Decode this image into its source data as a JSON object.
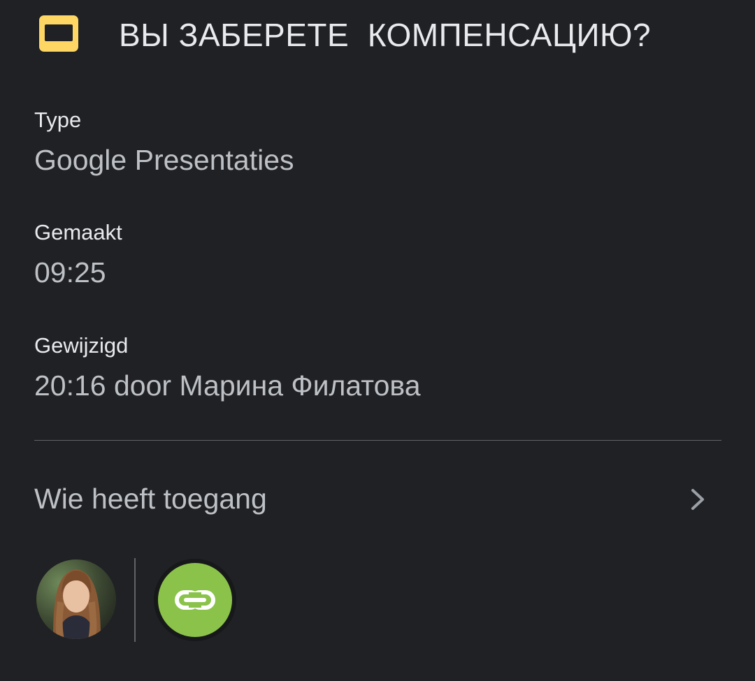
{
  "header": {
    "icon": "slides-icon",
    "icon_color": "#fdd663",
    "title": "ВЫ ЗАБЕРЕТЕ  КОМПЕНСАЦИЮ?"
  },
  "details": {
    "type_label": "Type",
    "type_value": "Google Presentaties",
    "created_label": "Gemaakt",
    "created_value": "09:25",
    "modified_label": "Gewijzigd",
    "modified_value": "20:16 door Марина Филатова"
  },
  "access": {
    "label": "Wie heeft toegang",
    "chevron_icon": "chevron-right-icon",
    "link_icon": "link-icon",
    "link_color": "#8bc34a"
  },
  "colors": {
    "background": "#202124",
    "text_primary": "#e8eaed",
    "text_secondary": "#bdc1c6",
    "divider": "#5f6368"
  }
}
